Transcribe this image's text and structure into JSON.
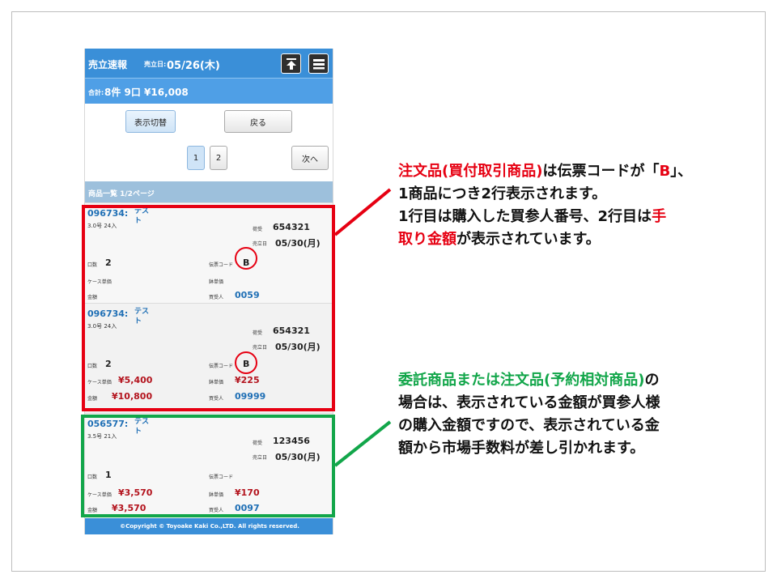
{
  "header": {
    "app_title": "売立速報",
    "date_label": "売立日:",
    "date_value": "05/26(木)"
  },
  "summary": {
    "label": "合計:",
    "value": "8件 9口 ¥16,008"
  },
  "toolbar": {
    "toggle_label": "表示切替",
    "back_label": "戻る",
    "pages": [
      "1",
      "2"
    ],
    "next_label": "次へ"
  },
  "list_header": "商品一覧 1/2ページ",
  "labels": {
    "consignor": "荷受",
    "sale_date": "売立日",
    "units": "口数",
    "slip_code": "伝票コード",
    "case_price": "ケース単価",
    "unit_price": "鉢単価",
    "amount": "金額",
    "buyer": "買受人"
  },
  "items": [
    {
      "code": "096734:",
      "name": "テスト",
      "spec": "3.0号 24入",
      "consignor": "654321",
      "sale_date": "05/30(月)",
      "units": "2",
      "slip_code": "B",
      "case_price": "",
      "unit_price": "",
      "amount": "",
      "buyer": "0059"
    },
    {
      "code": "096734:",
      "name": "テスト",
      "spec": "3.0号 24入",
      "consignor": "654321",
      "sale_date": "05/30(月)",
      "units": "2",
      "slip_code": "B",
      "case_price": "¥5,400",
      "unit_price": "¥225",
      "amount": "¥10,800",
      "buyer": "09999"
    },
    {
      "code": "056577:",
      "name": "テスト",
      "spec": "3.5号 21入",
      "consignor": "123456",
      "sale_date": "05/30(月)",
      "units": "1",
      "slip_code": "",
      "case_price": "¥3,570",
      "unit_price": "¥170",
      "amount": "¥3,570",
      "buyer": "0097"
    }
  ],
  "footer": "©Copyright © Toyoake Kaki Co.,LTD. All rights reserved.",
  "annotation_red": {
    "l1_a": "注文品(買付取引商品)",
    "l1_b": "は伝票コードが「",
    "l1_c": "B",
    "l1_d": "」、",
    "l2": "1商品につき2行表示されます。",
    "l3_a": "1行目は購入した買参人番号、2行目は",
    "l3_b": "手",
    "l4_a": "取り金額",
    "l4_b": "が表示されています。"
  },
  "annotation_green": {
    "l1_a": "委託商品または注文品(予約相対商品)",
    "l1_b": "の",
    "l2": "場合は、表示されている金額が買参人様",
    "l3": "の購入金額ですので、表示されている金",
    "l4": "額から市場手数料が差し引かれます。"
  },
  "colors": {
    "header_blue": "#3a8fd8",
    "highlight_red": "#e60012",
    "highlight_green": "#12a64a",
    "price_red": "#b3131d",
    "link_blue": "#1f6fb5"
  }
}
